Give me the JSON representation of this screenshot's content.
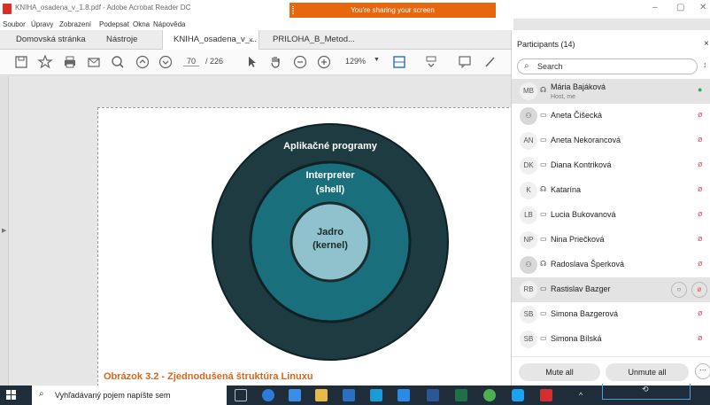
{
  "window": {
    "title": "KNIHA_osadena_v_1.8.pdf - Adobe Acrobat Reader DC",
    "share_banner": "You're sharing your screen",
    "controls": [
      "–",
      "▢",
      "✕"
    ]
  },
  "menubar": [
    "Soubor",
    "Úpravy",
    "Zobrazení",
    "Podepsat",
    "Okna",
    "Nápověda"
  ],
  "tabs": {
    "home": "Domovská stránka",
    "tools": "Nástroje",
    "doc1": "KNIHA_osadena_v_...",
    "doc2": "PRILOHA_B_Metod...",
    "close_glyph": "×"
  },
  "toolbar": {
    "page_current": "70",
    "page_total": "/ 226",
    "zoom": "129%"
  },
  "diagram": {
    "outer_label": "Aplikačné programy",
    "middle_label_1": "Interpreter",
    "middle_label_2": "(shell)",
    "inner_label_1": "Jadro",
    "inner_label_2": "(kernel)",
    "caption": "Obrázok 3.2 - Zjednodušená štruktúra Linuxu",
    "colors": {
      "outer": "#1d3b40",
      "middle": "#1a6f7d",
      "inner": "#8fc2cc",
      "caption": "#d2691e"
    }
  },
  "participants": {
    "title": "Participants (14)",
    "search_placeholder": "Search",
    "list": [
      {
        "initials": "MB",
        "name": "Mária Bajáková",
        "sub": "Host, me",
        "device": "headset",
        "mic": "on"
      },
      {
        "initials": "",
        "name": "Aneta Čišecká",
        "device": "desktop",
        "mic": "muted"
      },
      {
        "initials": "AN",
        "name": "Aneta Nekorancová",
        "device": "desktop",
        "mic": "muted"
      },
      {
        "initials": "DK",
        "name": "Diana Kontriková",
        "device": "desktop",
        "mic": "muted"
      },
      {
        "initials": "K",
        "name": "Katarína",
        "device": "headset",
        "mic": "muted"
      },
      {
        "initials": "LB",
        "name": "Lucia Bukovanová",
        "device": "desktop",
        "mic": "muted"
      },
      {
        "initials": "NP",
        "name": "Nina Priečková",
        "device": "desktop",
        "mic": "muted"
      },
      {
        "initials": "",
        "name": "Radoslava Šperková",
        "device": "headset",
        "mic": "muted"
      },
      {
        "initials": "RB",
        "name": "Rastislav Bazger",
        "device": "desktop",
        "mic": "muted"
      },
      {
        "initials": "SB",
        "name": "Simona Bazgerová",
        "device": "desktop",
        "mic": "muted"
      },
      {
        "initials": "SB",
        "name": "Simona Bílská",
        "device": "desktop",
        "mic": "muted"
      }
    ],
    "mute_all": "Mute all",
    "unmute_all": "Unmute all",
    "more": "···"
  },
  "taskbar": {
    "search_text": "Vyhľadávaný pojem napíšte sem",
    "tray_caret": "^"
  }
}
